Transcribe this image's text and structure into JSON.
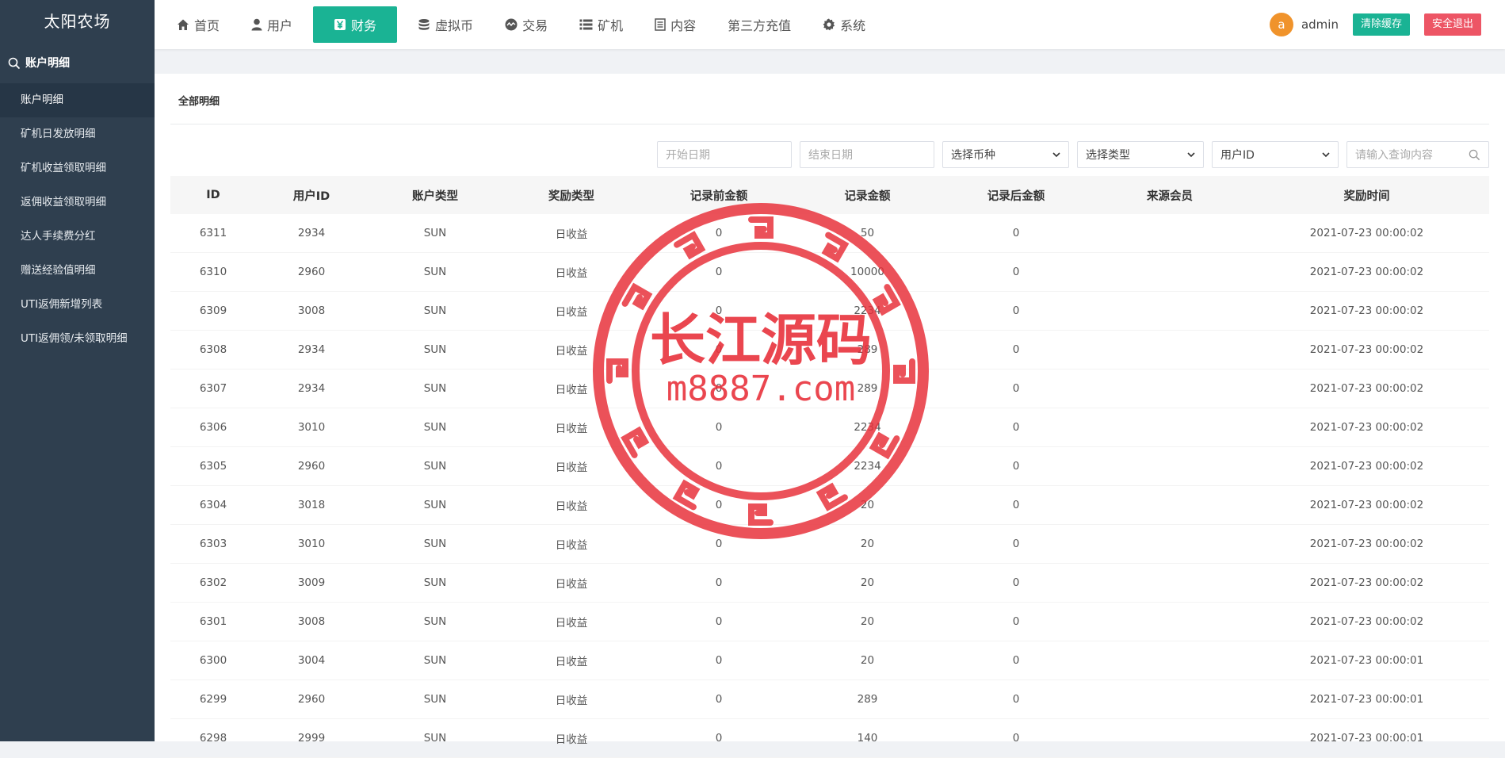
{
  "sidebar": {
    "brand": "太阳农场",
    "section_title": "账户明细",
    "items": [
      {
        "label": "账户明细",
        "active": true
      },
      {
        "label": "矿机日发放明细",
        "active": false
      },
      {
        "label": "矿机收益领取明细",
        "active": false
      },
      {
        "label": "返佣收益领取明细",
        "active": false
      },
      {
        "label": "达人手续费分红",
        "active": false
      },
      {
        "label": "赠送经验值明细",
        "active": false
      },
      {
        "label": "UTI返佣新增列表",
        "active": false
      },
      {
        "label": "UTI返佣领/未领取明细",
        "active": false
      }
    ]
  },
  "topnav": {
    "items": [
      {
        "label": "首页",
        "icon": "home-icon",
        "active": false
      },
      {
        "label": "用户",
        "icon": "user-icon",
        "active": false
      },
      {
        "label": "财务",
        "icon": "yen-icon",
        "active": true
      },
      {
        "label": "虚拟币",
        "icon": "database-icon",
        "active": false
      },
      {
        "label": "交易",
        "icon": "exchange-icon",
        "active": false
      },
      {
        "label": "矿机",
        "icon": "list-icon",
        "active": false
      },
      {
        "label": "内容",
        "icon": "document-icon",
        "active": false
      },
      {
        "label": "第三方充值",
        "icon": "",
        "active": false
      },
      {
        "label": "系统",
        "icon": "gear-icon",
        "active": false
      }
    ],
    "avatar_letter": "a",
    "username": "admin",
    "clear_cache_label": "清除缓存",
    "logout_label": "安全退出"
  },
  "panel": {
    "title": "全部明细"
  },
  "filters": {
    "start_date_placeholder": "开始日期",
    "end_date_placeholder": "结束日期",
    "currency_select": "选择币种",
    "type_select": "选择类型",
    "field_select": "用户ID",
    "search_placeholder": "请输入查询内容"
  },
  "table": {
    "columns": [
      "ID",
      "用户ID",
      "账户类型",
      "奖励类型",
      "记录前金额",
      "记录金额",
      "记录后金额",
      "来源会员",
      "奖励时间"
    ],
    "rows": [
      [
        "6311",
        "2934",
        "SUN",
        "日收益",
        "0",
        "50",
        "0",
        "",
        "2021-07-23 00:00:02"
      ],
      [
        "6310",
        "2960",
        "SUN",
        "日收益",
        "0",
        "10000",
        "0",
        "",
        "2021-07-23 00:00:02"
      ],
      [
        "6309",
        "3008",
        "SUN",
        "日收益",
        "0",
        "2234",
        "0",
        "",
        "2021-07-23 00:00:02"
      ],
      [
        "6308",
        "2934",
        "SUN",
        "日收益",
        "0",
        "289",
        "0",
        "",
        "2021-07-23 00:00:02"
      ],
      [
        "6307",
        "2934",
        "SUN",
        "日收益",
        "0",
        "289",
        "0",
        "",
        "2021-07-23 00:00:02"
      ],
      [
        "6306",
        "3010",
        "SUN",
        "日收益",
        "0",
        "2234",
        "0",
        "",
        "2021-07-23 00:00:02"
      ],
      [
        "6305",
        "2960",
        "SUN",
        "日收益",
        "0",
        "2234",
        "0",
        "",
        "2021-07-23 00:00:02"
      ],
      [
        "6304",
        "3018",
        "SUN",
        "日收益",
        "0",
        "20",
        "0",
        "",
        "2021-07-23 00:00:02"
      ],
      [
        "6303",
        "3010",
        "SUN",
        "日收益",
        "0",
        "20",
        "0",
        "",
        "2021-07-23 00:00:02"
      ],
      [
        "6302",
        "3009",
        "SUN",
        "日收益",
        "0",
        "20",
        "0",
        "",
        "2021-07-23 00:00:02"
      ],
      [
        "6301",
        "3008",
        "SUN",
        "日收益",
        "0",
        "20",
        "0",
        "",
        "2021-07-23 00:00:02"
      ],
      [
        "6300",
        "3004",
        "SUN",
        "日收益",
        "0",
        "20",
        "0",
        "",
        "2021-07-23 00:00:01"
      ],
      [
        "6299",
        "2960",
        "SUN",
        "日收益",
        "0",
        "289",
        "0",
        "",
        "2021-07-23 00:00:01"
      ],
      [
        "6298",
        "2999",
        "SUN",
        "日收益",
        "0",
        "140",
        "0",
        "",
        "2021-07-23 00:00:01"
      ]
    ]
  },
  "watermark": {
    "line1": "长江源码",
    "line2": "m8887.com",
    "color": "#e8323c"
  },
  "colors": {
    "sidebar_bg": "#2f3f4f",
    "accent": "#1ab394",
    "danger": "#ed5565",
    "avatar": "#f0932b"
  }
}
